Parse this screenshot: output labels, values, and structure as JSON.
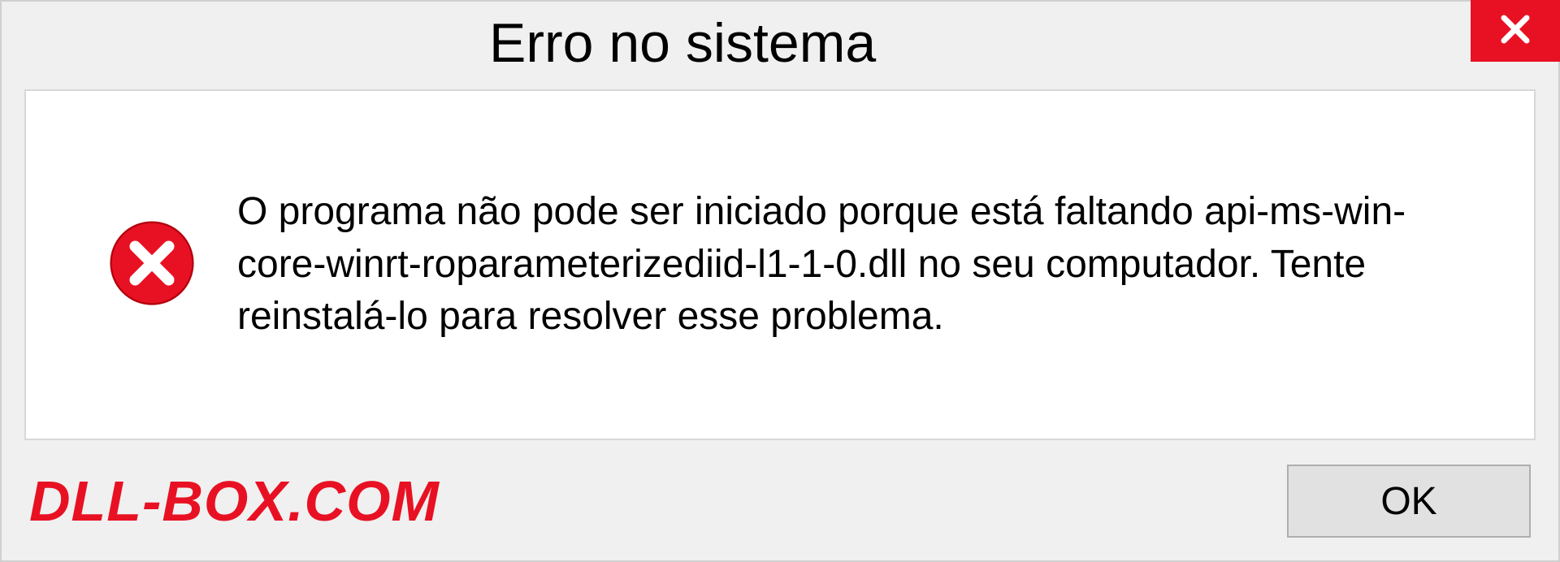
{
  "titlebar": {
    "title": "Erro no sistema"
  },
  "content": {
    "message": "O programa não pode ser iniciado porque está faltando api-ms-win-core-winrt-roparameterizediid-l1-1-0.dll no seu computador. Tente reinstalá-lo para resolver esse problema."
  },
  "footer": {
    "watermark": "DLL-BOX.COM",
    "ok_label": "OK"
  },
  "icons": {
    "close": "close-icon",
    "error": "error-circle-icon"
  }
}
